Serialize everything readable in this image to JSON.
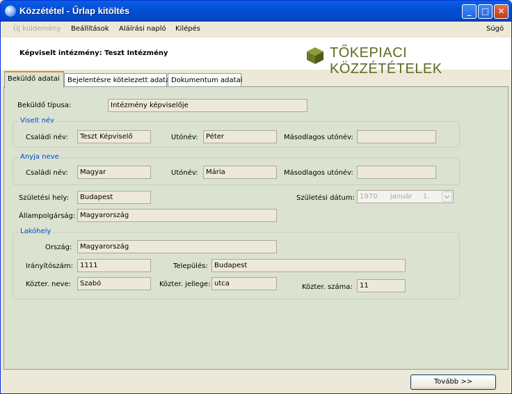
{
  "window": {
    "title": "Közzététel - Űrlap kitöltés"
  },
  "menu": {
    "new_submission": "Új küldemény",
    "settings": "Beállítások",
    "signing_log": "Aláírási napló",
    "exit": "Kilépés",
    "help": "Súgó"
  },
  "header": {
    "institution": "Képviselt intézmény: Teszt Intézmény",
    "logo_text": "TŐKEPIACI KÖZZÉTÉTELEK"
  },
  "tabs": [
    "Beküldő adatai",
    "Bejelentésre kötelezett adatai",
    "Dokumentum adatai"
  ],
  "form": {
    "sender_type_label": "Beküldő típusa:",
    "sender_type_value": "Intézmény képviselője",
    "worn_name": {
      "title": "Viselt név",
      "family_label": "Családi név:",
      "family_value": "Teszt Képviselő",
      "given_label": "Utónév:",
      "given_value": "Péter",
      "second_label": "Másodlagos utónév:",
      "second_value": ""
    },
    "mother_name": {
      "title": "Anyja neve",
      "family_label": "Családi név:",
      "family_value": "Magyar",
      "given_label": "Utónév:",
      "given_value": "Mária",
      "second_label": "Másodlagos utónév:",
      "second_value": ""
    },
    "birth_place_label": "Születési hely:",
    "birth_place_value": "Budapest",
    "birth_date_label": "Születési dátum:",
    "birth_date": {
      "year": "1970.",
      "month": "január",
      "day": "1."
    },
    "citizenship_label": "Állampolgárság:",
    "citizenship_value": "Magyarország",
    "residence": {
      "title": "Lakóhely",
      "country_label": "Ország:",
      "country_value": "Magyarország",
      "zip_label": "Irányítószám:",
      "zip_value": "1111",
      "city_label": "Település:",
      "city_value": "Budapest",
      "street_label": "Közter. neve:",
      "street_value": "Szabó",
      "street_type_label": "Közter. jellege:",
      "street_type_value": "utca",
      "house_label": "Közter. száma:",
      "house_value": "11"
    }
  },
  "buttons": {
    "next": "Tovább >>"
  }
}
